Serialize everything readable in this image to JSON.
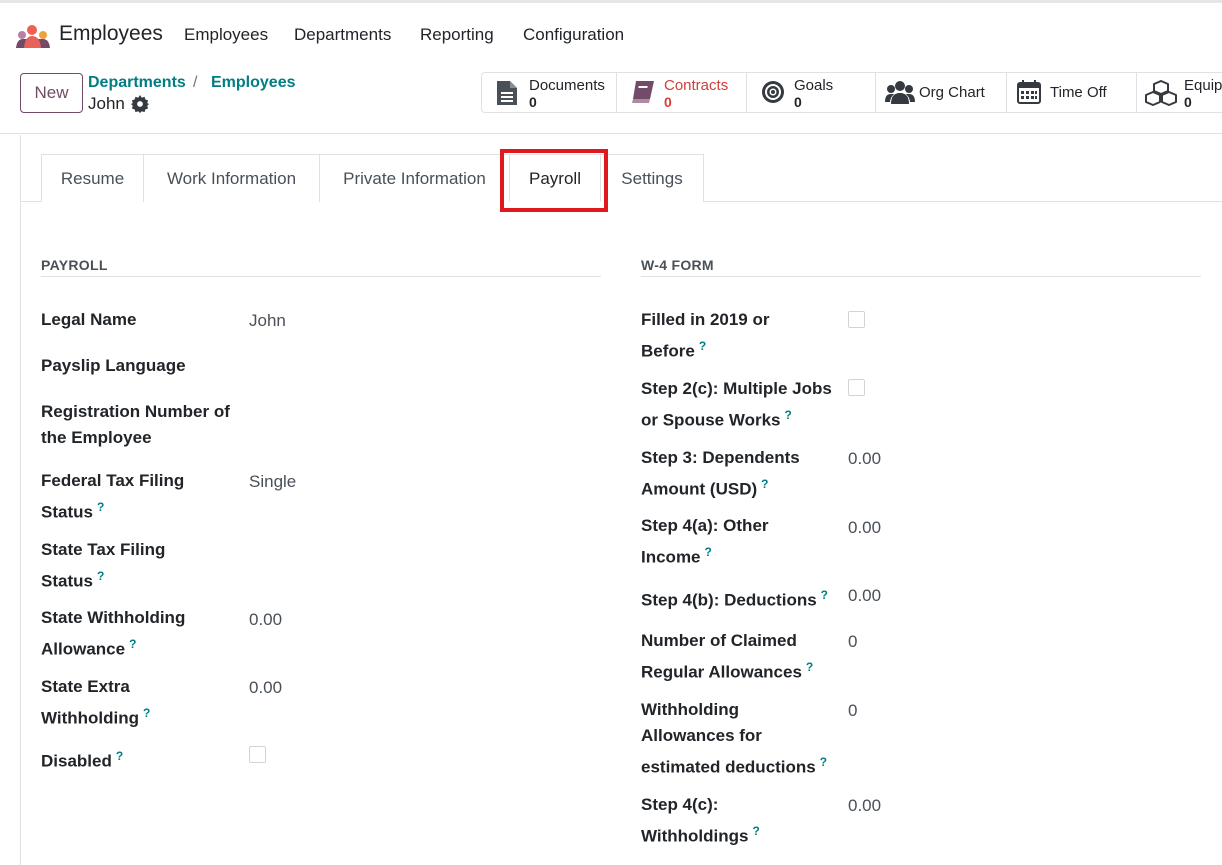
{
  "topbar": {
    "app_name": "Employees",
    "menu": [
      "Employees",
      "Departments",
      "Reporting",
      "Configuration"
    ]
  },
  "control": {
    "new_label": "New",
    "breadcrumb": [
      "Departments",
      "Employees"
    ],
    "record_name": "John"
  },
  "smart_buttons": [
    {
      "label": "Documents",
      "value": "0",
      "icon": "file-text-icon"
    },
    {
      "label": "Contracts",
      "value": "0",
      "icon": "book-icon",
      "color": "#d23f3a"
    },
    {
      "label": "Goals",
      "value": "0",
      "icon": "bullseye-icon"
    },
    {
      "label": "Org Chart",
      "icon": "users-icon"
    },
    {
      "label": "Time Off",
      "icon": "calendar-icon"
    },
    {
      "label": "Equipment",
      "value": "0",
      "icon": "cubes-icon"
    }
  ],
  "tabs": [
    "Resume",
    "Work Information",
    "Private Information",
    "Payroll",
    "Settings"
  ],
  "active_tab": "Payroll",
  "payroll": {
    "title": "PAYROLL",
    "fields": [
      {
        "label": "Legal Name",
        "value": "John"
      },
      {
        "label": "Payslip Language",
        "value": ""
      },
      {
        "label": "Registration Number of the Employee",
        "value": ""
      },
      {
        "label": "Federal Tax Filing Status",
        "value": "Single",
        "help": "?"
      },
      {
        "label": "State Tax Filing Status",
        "value": "",
        "help": "?"
      },
      {
        "label": "State Withholding Allowance",
        "value": "0.00",
        "help": "?"
      },
      {
        "label": "State Extra Withholding",
        "value": "0.00",
        "help": "?"
      },
      {
        "label": "Disabled",
        "checked": false,
        "help": "?"
      }
    ]
  },
  "w4": {
    "title": "W-4 FORM",
    "fields": [
      {
        "label": "Filled in 2019 or Before",
        "checked": false,
        "help": "?"
      },
      {
        "label": "Step 2(c): Multiple Jobs or Spouse Works",
        "checked": false,
        "help": "?"
      },
      {
        "label": "Step 3: Dependents Amount (USD)",
        "value": "0.00",
        "help": "?"
      },
      {
        "label": "Step 4(a): Other Income",
        "value": "0.00",
        "help": "?"
      },
      {
        "label": "Step 4(b): Deductions",
        "value": "0.00",
        "help": "?"
      },
      {
        "label": "Number of Claimed Regular Allowances",
        "value": "0",
        "help": "?"
      },
      {
        "label": "Withholding Allowances for estimated deductions",
        "value": "0",
        "help": "?"
      },
      {
        "label": "Step 4(c): Withholdings",
        "value": "0.00",
        "help": "?"
      }
    ]
  },
  "colors": {
    "accent": "#017e84",
    "brand": "#714b67",
    "alert": "#d23f3a",
    "highlight": "#e0191d"
  }
}
